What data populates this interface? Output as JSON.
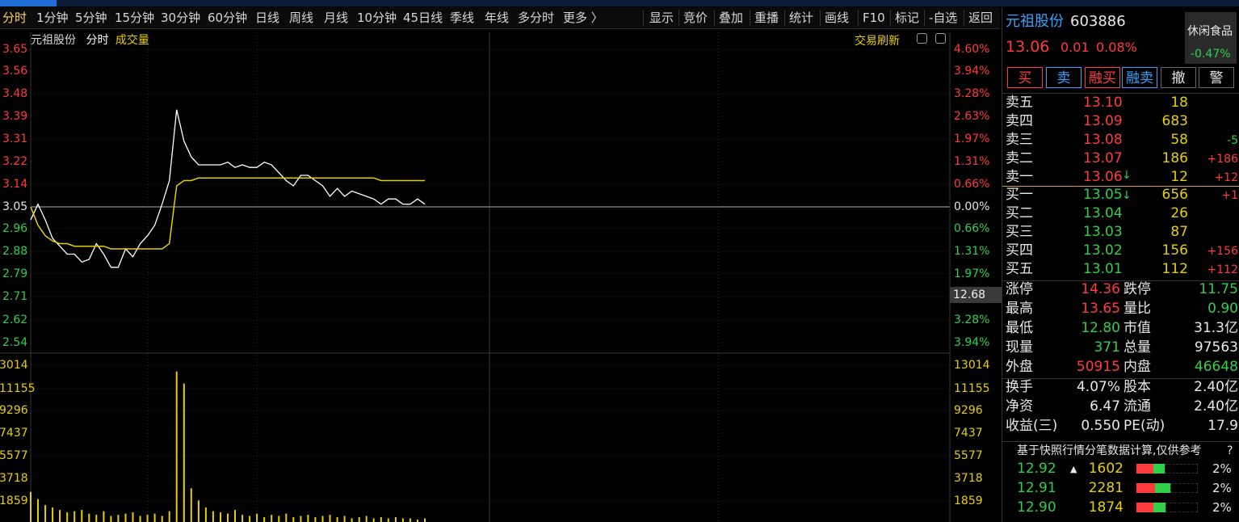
{
  "tabs": [
    "分时",
    "1分钟",
    "5分钟",
    "15分钟",
    "30分钟",
    "60分钟",
    "日线",
    "周线",
    "月线",
    "10分钟",
    "45日线",
    "季线",
    "年线",
    "多分时",
    "更多 〉"
  ],
  "tools": [
    "显示",
    "竞价",
    "叠加",
    "重播",
    "统计",
    "画线",
    "F10",
    "标记",
    "-自选",
    "返回"
  ],
  "chart": {
    "stock_name": "元祖股份",
    "mode": "分时",
    "indicator": "成交量",
    "refresh": "交易刷新",
    "price_labels": [
      "3.65",
      "3.56",
      "3.48",
      "3.39",
      "3.31",
      "3.22",
      "3.14",
      "3.05",
      "2.96",
      "2.88",
      "2.79",
      "2.71",
      "2.62",
      "2.54"
    ],
    "pct_labels": [
      "4.60%",
      "3.94%",
      "3.28%",
      "2.63%",
      "1.97%",
      "1.31%",
      "0.66%",
      "0.00%",
      "0.66%",
      "1.31%",
      "1.97%",
      "",
      "3.28%",
      "3.94%"
    ],
    "current_tag": "12.68",
    "volume_labels": [
      "3014",
      "11155",
      "9296",
      "7437",
      "5577",
      "3718",
      "1859"
    ],
    "volume_labels_right": [
      "13014",
      "11155",
      "9296",
      "7437",
      "5577",
      "3718",
      "1859"
    ]
  },
  "chart_data": {
    "type": "line",
    "series": [
      {
        "values": [
          3.0,
          3.06,
          3.0,
          2.93,
          2.9,
          2.87,
          2.87,
          2.84,
          2.85,
          2.91,
          2.87,
          2.82,
          2.82,
          2.89,
          2.86,
          2.91,
          2.94,
          2.98,
          3.06,
          3.15,
          3.42,
          3.3,
          3.24,
          3.21,
          3.21,
          3.21,
          3.21,
          3.22,
          3.2,
          3.21,
          3.2,
          3.2,
          3.22,
          3.21,
          3.18,
          3.15,
          3.13,
          3.17,
          3.17,
          3.15,
          3.13,
          3.09,
          3.12,
          3.09,
          3.11,
          3.1,
          3.09,
          3.08,
          3.06,
          3.08,
          3.08,
          3.06,
          3.06,
          3.08,
          3.06
        ]
      },
      {
        "values": [
          3.05,
          2.98,
          2.94,
          2.92,
          2.91,
          2.91,
          2.9,
          2.9,
          2.9,
          2.9,
          2.9,
          2.89,
          2.89,
          2.89,
          2.89,
          2.89,
          2.89,
          2.89,
          2.89,
          2.91,
          3.13,
          3.15,
          3.15,
          3.16,
          3.16,
          3.16,
          3.16,
          3.16,
          3.16,
          3.16,
          3.16,
          3.16,
          3.16,
          3.16,
          3.16,
          3.16,
          3.16,
          3.16,
          3.16,
          3.16,
          3.16,
          3.16,
          3.16,
          3.16,
          3.16,
          3.16,
          3.16,
          3.16,
          3.15,
          3.15,
          3.15,
          3.15,
          3.15,
          3.15,
          3.15
        ]
      }
    ],
    "volume": [
      2500,
      1900,
      1400,
      1200,
      1000,
      800,
      900,
      1000,
      700,
      600,
      900,
      500,
      600,
      700,
      800,
      500,
      600,
      700,
      500,
      900,
      12500,
      11500,
      2800,
      1800,
      1200,
      900,
      800,
      700,
      1000,
      600,
      500,
      700,
      400,
      600,
      500,
      700,
      400,
      500,
      600,
      400,
      500,
      600,
      400,
      500,
      300,
      400,
      500,
      300,
      400,
      300,
      400,
      300,
      300,
      200,
      300
    ],
    "ylim": [
      2.5,
      3.68
    ],
    "volume_max": 13014,
    "grid": true
  },
  "panel": {
    "name": "元祖股份",
    "code": "603886",
    "price": "13.06",
    "change": "0.01",
    "change_pct": "0.08%",
    "industry": "休闲食品",
    "industry_pct": "-0.47%",
    "buttons": [
      "买",
      "卖",
      "融买",
      "融卖",
      "撤",
      "警"
    ],
    "sells": [
      {
        "label": "卖五",
        "price": "13.10",
        "vol": "18",
        "chg": ""
      },
      {
        "label": "卖四",
        "price": "13.09",
        "vol": "683",
        "chg": ""
      },
      {
        "label": "卖三",
        "price": "13.08",
        "vol": "58",
        "chg": "-5"
      },
      {
        "label": "卖二",
        "price": "13.07",
        "vol": "186",
        "chg": "+186"
      },
      {
        "label": "卖一",
        "price": "13.06",
        "vol": "12",
        "chg": "+12"
      }
    ],
    "buys": [
      {
        "label": "买一",
        "price": "13.05",
        "vol": "656",
        "chg": "+1"
      },
      {
        "label": "买二",
        "price": "13.04",
        "vol": "26",
        "chg": ""
      },
      {
        "label": "买三",
        "price": "13.03",
        "vol": "87",
        "chg": ""
      },
      {
        "label": "买四",
        "price": "13.02",
        "vol": "156",
        "chg": "+156"
      },
      {
        "label": "买五",
        "price": "13.01",
        "vol": "112",
        "chg": "+112"
      }
    ],
    "stats": [
      {
        "k1": "涨停",
        "v1": "14.36",
        "c1": "red",
        "k2": "跌停",
        "v2": "11.75",
        "c2": "green"
      },
      {
        "k1": "最高",
        "v1": "13.65",
        "c1": "red",
        "k2": "量比",
        "v2": "0.90",
        "c2": "green"
      },
      {
        "k1": "最低",
        "v1": "12.80",
        "c1": "green",
        "k2": "市值",
        "v2": "31.3亿",
        "c2": "white"
      },
      {
        "k1": "现量",
        "v1": "371",
        "c1": "green",
        "k2": "总量",
        "v2": "97563",
        "c2": "white"
      },
      {
        "k1": "外盘",
        "v1": "50915",
        "c1": "red",
        "k2": "内盘",
        "v2": "46648",
        "c2": "green"
      }
    ],
    "stats2": [
      {
        "k1": "换手",
        "v1": "4.07%",
        "k2": "股本",
        "v2": "2.40亿"
      },
      {
        "k1": "净资",
        "v1": "6.47",
        "k2": "流通",
        "v2": "2.40亿"
      },
      {
        "k1": "收益(三)",
        "v1": "0.550",
        "k2": "PE(动)",
        "v2": "17.9"
      }
    ],
    "note": "基于快照行情分笔数据计算,仅供参考",
    "note_q": "?",
    "flows": [
      {
        "price": "12.92",
        "mark": "▲",
        "vol": "1602",
        "pct": "2%",
        "red": 0.28,
        "green": 0.18
      },
      {
        "price": "12.91",
        "mark": "",
        "vol": "2281",
        "pct": "2%",
        "red": 0.3,
        "green": 0.25
      },
      {
        "price": "12.90",
        "mark": "",
        "vol": "1874",
        "pct": "2%",
        "red": 0.27,
        "green": 0.2
      }
    ]
  }
}
